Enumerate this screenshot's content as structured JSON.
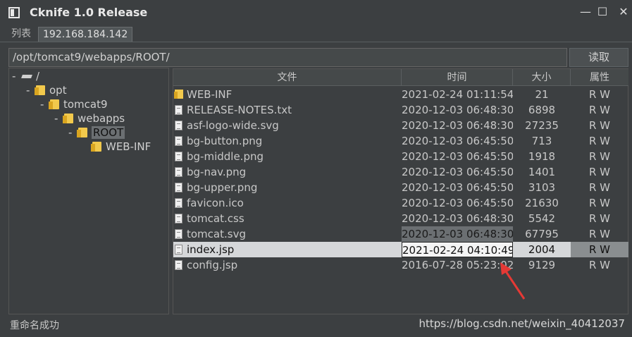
{
  "window": {
    "title": "Cknife 1.0 Release",
    "minimize": "—",
    "maximize": "☐",
    "close": "✕"
  },
  "tabs": [
    {
      "label": "列表"
    },
    {
      "label": "192.168.184.142"
    }
  ],
  "path": {
    "value": "/opt/tomcat9/webapps/ROOT/",
    "read_label": "读取"
  },
  "tree": [
    {
      "label": "/",
      "exp": "-",
      "type": "drive"
    },
    {
      "label": "opt",
      "exp": "-",
      "type": "folder"
    },
    {
      "label": "tomcat9",
      "exp": "-",
      "type": "folder"
    },
    {
      "label": "webapps",
      "exp": "-",
      "type": "folder"
    },
    {
      "label": "ROOT",
      "exp": "-",
      "type": "folder",
      "selected": true
    },
    {
      "label": "WEB-INF",
      "exp": "",
      "type": "folder"
    }
  ],
  "table": {
    "columns": [
      "文件",
      "时间",
      "大小",
      "属性"
    ],
    "rows": [
      {
        "name": "WEB-INF",
        "time": "2021-02-24 01:11:54",
        "size": "21",
        "attr": "R W",
        "type": "folder"
      },
      {
        "name": "RELEASE-NOTES.txt",
        "time": "2020-12-03 06:48:30",
        "size": "6898",
        "attr": "R W",
        "type": "file"
      },
      {
        "name": "asf-logo-wide.svg",
        "time": "2020-12-03 06:48:30",
        "size": "27235",
        "attr": "R W",
        "type": "file"
      },
      {
        "name": "bg-button.png",
        "time": "2020-12-03 06:45:50",
        "size": "713",
        "attr": "R W",
        "type": "file"
      },
      {
        "name": "bg-middle.png",
        "time": "2020-12-03 06:45:50",
        "size": "1918",
        "attr": "R W",
        "type": "file"
      },
      {
        "name": "bg-nav.png",
        "time": "2020-12-03 06:45:50",
        "size": "1401",
        "attr": "R W",
        "type": "file"
      },
      {
        "name": "bg-upper.png",
        "time": "2020-12-03 06:45:50",
        "size": "3103",
        "attr": "R W",
        "type": "file"
      },
      {
        "name": "favicon.ico",
        "time": "2020-12-03 06:45:50",
        "size": "21630",
        "attr": "R W",
        "type": "file"
      },
      {
        "name": "tomcat.css",
        "time": "2020-12-03 06:48:30",
        "size": "5542",
        "attr": "R W",
        "type": "file"
      },
      {
        "name": "tomcat.svg",
        "time": "2020-12-03 06:48:30",
        "size": "67795",
        "attr": "R W",
        "type": "file",
        "highlight": true
      },
      {
        "name": "index.jsp",
        "time": "2021-02-24 04:10:49",
        "size": "2004",
        "attr": "R W",
        "type": "file",
        "selected": true
      },
      {
        "name": "config.jsp",
        "time": "2016-07-28 05:23:02",
        "size": "9129",
        "attr": "R W",
        "type": "file"
      }
    ]
  },
  "status": {
    "message": "重命名成功"
  },
  "watermark": "https://blog.csdn.net/weixin_40412037",
  "annotation": {
    "color": "#e53935"
  }
}
